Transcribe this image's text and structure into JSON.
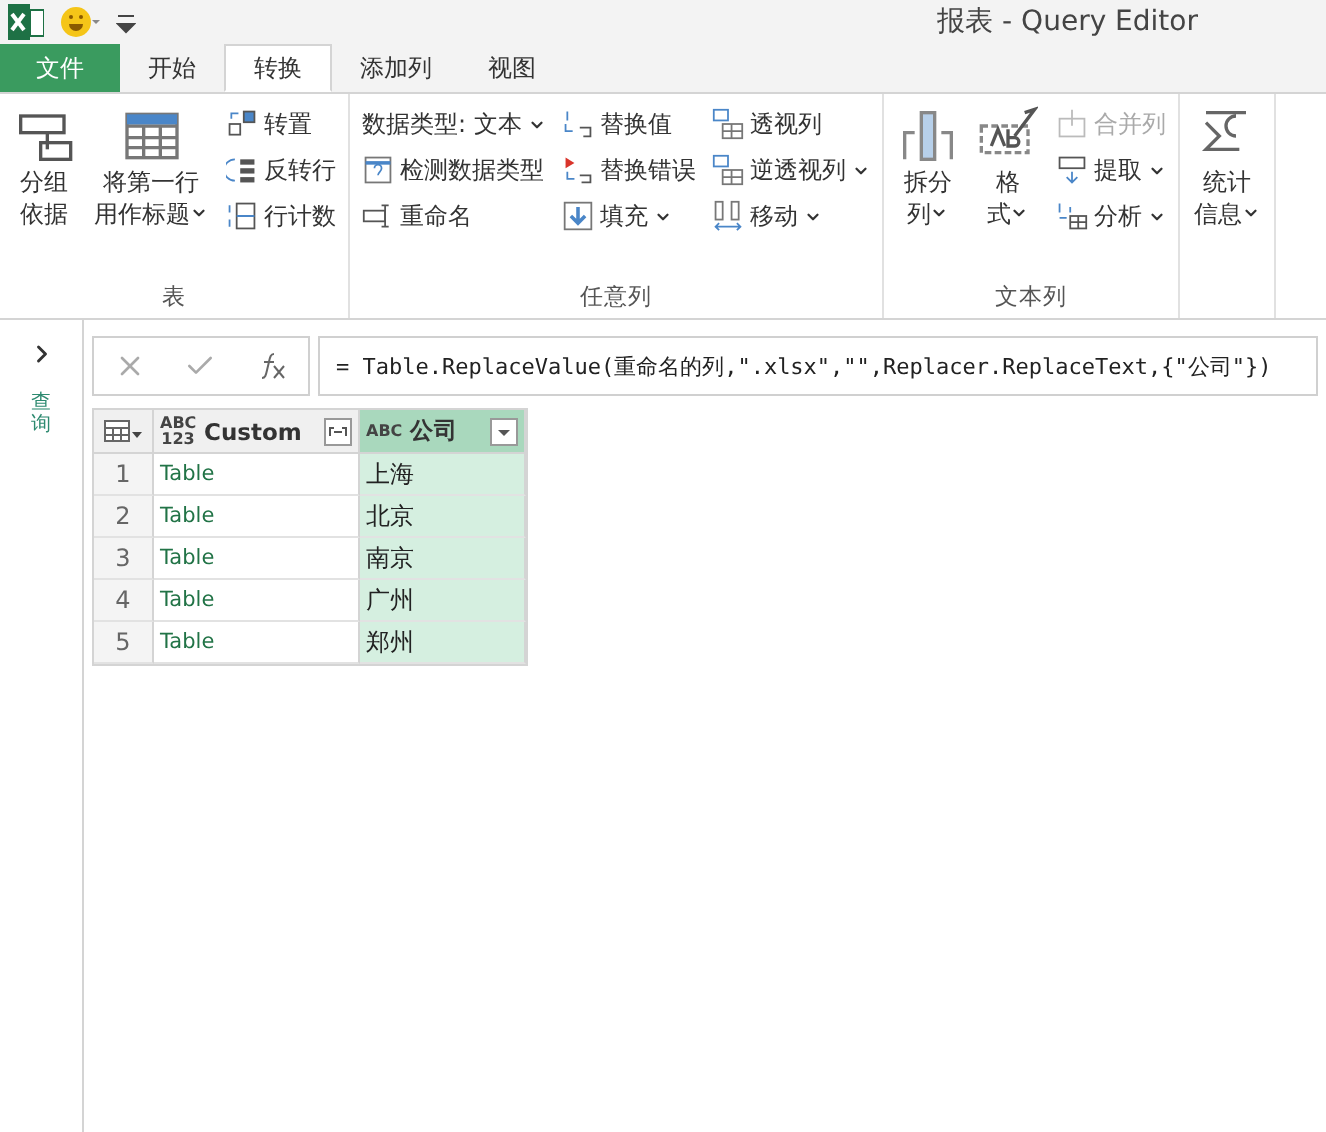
{
  "window": {
    "title": "报表 - Query Editor"
  },
  "tabs": [
    {
      "label": "文件",
      "kind": "file",
      "selected": false
    },
    {
      "label": "开始",
      "kind": "tab",
      "selected": false
    },
    {
      "label": "转换",
      "kind": "tab",
      "selected": true
    },
    {
      "label": "添加列",
      "kind": "tab",
      "selected": false
    },
    {
      "label": "视图",
      "kind": "tab",
      "selected": false
    }
  ],
  "ribbon_groups": [
    {
      "label": "表",
      "large": [
        {
          "lines": [
            "分组",
            "依据"
          ],
          "dropdown": false
        },
        {
          "lines": [
            "将第一行",
            "用作标题"
          ],
          "dropdown": true
        }
      ],
      "columns": [
        [
          {
            "label": "转置",
            "dropdown": false,
            "disabled": false
          },
          {
            "label": "反转行",
            "dropdown": false,
            "disabled": false
          },
          {
            "label": "行计数",
            "dropdown": false,
            "disabled": false
          }
        ]
      ]
    },
    {
      "label": "任意列",
      "columns": [
        [
          {
            "label": "数据类型: 文本",
            "dropdown": true,
            "disabled": false
          },
          {
            "label": "检测数据类型",
            "dropdown": false,
            "disabled": false
          },
          {
            "label": "重命名",
            "dropdown": false,
            "disabled": false
          }
        ],
        [
          {
            "label": "替换值",
            "dropdown": false,
            "disabled": false
          },
          {
            "label": "替换错误",
            "dropdown": false,
            "disabled": false
          },
          {
            "label": "填充",
            "dropdown": true,
            "disabled": false
          }
        ],
        [
          {
            "label": "透视列",
            "dropdown": false,
            "disabled": false
          },
          {
            "label": "逆透视列",
            "dropdown": true,
            "disabled": false
          },
          {
            "label": "移动",
            "dropdown": true,
            "disabled": false
          }
        ]
      ]
    },
    {
      "label": "文本列",
      "large": [
        {
          "lines": [
            "拆分",
            "列"
          ],
          "dropdown": true
        },
        {
          "lines": [
            "格",
            "式"
          ],
          "dropdown": true
        }
      ],
      "columns": [
        [
          {
            "label": "合并列",
            "dropdown": false,
            "disabled": true
          },
          {
            "label": "提取",
            "dropdown": true,
            "disabled": false
          },
          {
            "label": "分析",
            "dropdown": true,
            "disabled": false
          }
        ]
      ]
    },
    {
      "large": [
        {
          "lines": [
            "统计",
            "信息"
          ],
          "dropdown": true
        }
      ]
    }
  ],
  "sidebar": {
    "label": "查询"
  },
  "formula_bar": {
    "formula": "= Table.ReplaceValue(重命名的列,\".xlsx\",\"\",Replacer.ReplaceText,{\"公司\"})"
  },
  "table": {
    "columns": [
      {
        "name": "Custom",
        "type": "ABC 123",
        "selected": false
      },
      {
        "name": "公司",
        "type": "ABC",
        "selected": true
      }
    ],
    "rows": [
      {
        "index": "1",
        "cells": [
          "Table",
          "上海"
        ]
      },
      {
        "index": "2",
        "cells": [
          "Table",
          "北京"
        ]
      },
      {
        "index": "3",
        "cells": [
          "Table",
          "南京"
        ]
      },
      {
        "index": "4",
        "cells": [
          "Table",
          "广州"
        ]
      },
      {
        "index": "5",
        "cells": [
          "Table",
          "郑州"
        ]
      }
    ]
  }
}
